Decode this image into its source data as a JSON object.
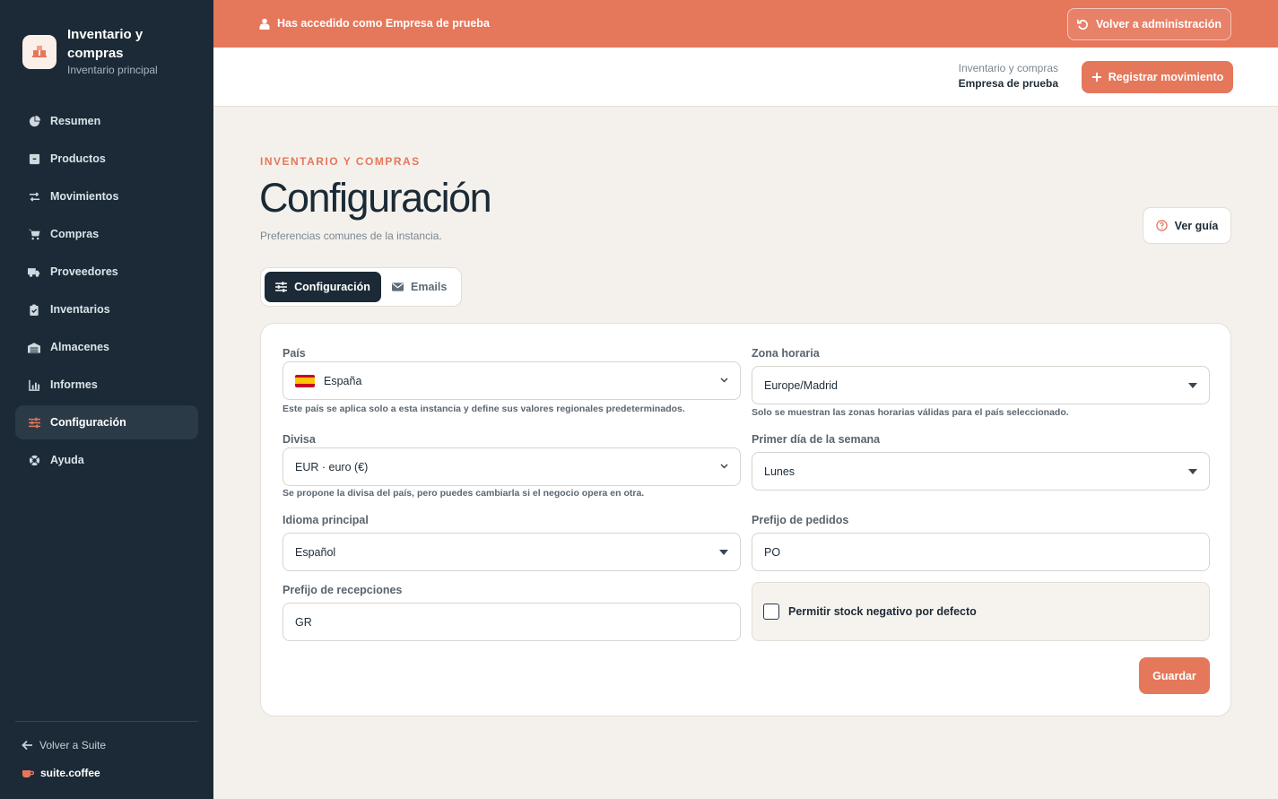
{
  "sidebar": {
    "brand_title": "Inventario y compras",
    "brand_subtitle": "Inventario principal",
    "items": [
      {
        "label": "Resumen",
        "icon": "pie-chart-icon"
      },
      {
        "label": "Productos",
        "icon": "box-icon"
      },
      {
        "label": "Movimientos",
        "icon": "swap-arrows-icon"
      },
      {
        "label": "Compras",
        "icon": "cart-icon"
      },
      {
        "label": "Proveedores",
        "icon": "truck-icon"
      },
      {
        "label": "Inventarios",
        "icon": "clipboard-check-icon"
      },
      {
        "label": "Almacenes",
        "icon": "warehouse-icon"
      },
      {
        "label": "Informes",
        "icon": "bar-chart-icon"
      },
      {
        "label": "Configuración",
        "icon": "sliders-icon",
        "active": true
      },
      {
        "label": "Ayuda",
        "icon": "lifebuoy-icon"
      }
    ],
    "back_label": "Volver a Suite",
    "suite_label": "suite.coffee"
  },
  "banner": {
    "text": "Has accedido como Empresa de prueba",
    "button": "Volver a administración"
  },
  "header": {
    "context_line1": "Inventario y compras",
    "context_line2": "Empresa de prueba",
    "button": "Registrar movimiento"
  },
  "page": {
    "eyebrow": "INVENTARIO Y COMPRAS",
    "title": "Configuración",
    "subtitle": "Preferencias comunes de la instancia.",
    "guide_button": "Ver guía"
  },
  "tabs": [
    {
      "label": "Configuración",
      "active": true
    },
    {
      "label": "Emails",
      "active": false
    }
  ],
  "form": {
    "country": {
      "label": "País",
      "value": "España",
      "help": "Este país se aplica solo a esta instancia y define sus valores regionales predeterminados."
    },
    "timezone": {
      "label": "Zona horaria",
      "value": "Europe/Madrid",
      "help": "Solo se muestran las zonas horarias válidas para el país seleccionado."
    },
    "currency": {
      "label": "Divisa",
      "value": "EUR · euro (€)",
      "help": "Se propone la divisa del país, pero puedes cambiarla si el negocio opera en otra."
    },
    "first_day": {
      "label": "Primer día de la semana",
      "value": "Lunes"
    },
    "language": {
      "label": "Idioma principal",
      "value": "Español"
    },
    "order_prefix": {
      "label": "Prefijo de pedidos",
      "value": "PO"
    },
    "receipt_prefix": {
      "label": "Prefijo de recepciones",
      "value": "GR"
    },
    "negative_stock": {
      "label": "Permitir stock negativo por defecto",
      "checked": false
    },
    "save_button": "Guardar"
  },
  "colors": {
    "accent": "#e5775b",
    "sidebar_bg": "#1b2a36",
    "page_bg": "#f4f1ec"
  }
}
